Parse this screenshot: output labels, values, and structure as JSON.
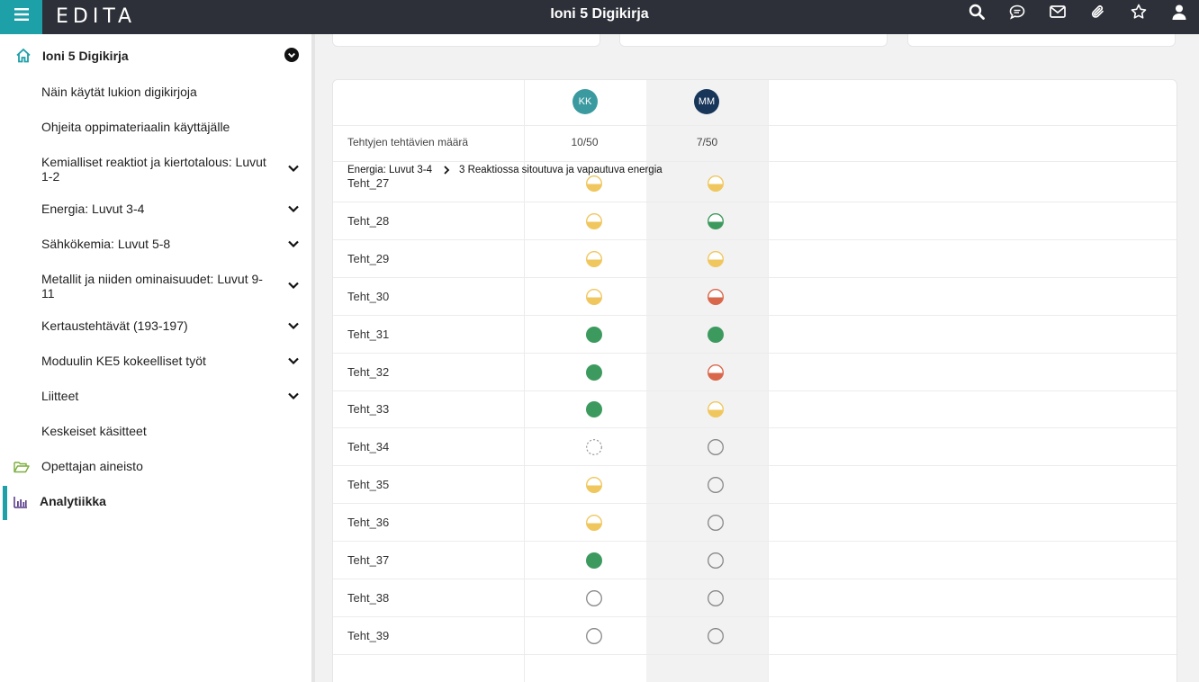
{
  "header": {
    "logo": "EDITA",
    "title": "Ioni 5 Digikirja",
    "icons": [
      "search-icon",
      "chat-icon",
      "mail-icon",
      "attachment-icon",
      "star-icon",
      "user-icon"
    ]
  },
  "sidebar": {
    "root": "Ioni 5 Digikirja",
    "items": [
      {
        "label": "Näin käytät lukion digikirjoja",
        "expandable": false
      },
      {
        "label": "Ohjeita oppimateriaalin käyttäjälle",
        "expandable": false
      },
      {
        "label": "Kemialliset reaktiot ja kiertotalous: Luvut 1-2",
        "expandable": true
      },
      {
        "label": "Energia: Luvut 3-4",
        "expandable": true
      },
      {
        "label": "Sähkökemia: Luvut 5-8",
        "expandable": true
      },
      {
        "label": "Metallit ja niiden ominaisuudet: Luvut 9-11",
        "expandable": true
      },
      {
        "label": "Kertaustehtävät (193-197)",
        "expandable": true
      },
      {
        "label": "Moduulin KE5 kokeelliset työt",
        "expandable": true
      },
      {
        "label": "Liitteet",
        "expandable": true
      },
      {
        "label": "Keskeiset käsitteet",
        "expandable": false
      }
    ],
    "teacher": "Opettajan aineisto",
    "analytics": "Analytiikka"
  },
  "table": {
    "students": [
      {
        "initials": "KK",
        "color": "#3b9aa0",
        "done": "10/50"
      },
      {
        "initials": "MM",
        "color": "#17365a",
        "done": "7/50"
      }
    ],
    "count_label": "Tehtyjen tehtävien määrä",
    "breadcrumb": {
      "chapter": "Energia: Luvut 3-4",
      "section": "3 Reaktiossa sitoutuva ja vapautuva energia"
    },
    "rows": [
      {
        "task": "Teht_27",
        "status": [
          "partial-yellow",
          "partial-yellow"
        ]
      },
      {
        "task": "Teht_28",
        "status": [
          "partial-yellow",
          "partial-green"
        ]
      },
      {
        "task": "Teht_29",
        "status": [
          "partial-yellow",
          "partial-yellow"
        ]
      },
      {
        "task": "Teht_30",
        "status": [
          "partial-yellow",
          "partial-red"
        ]
      },
      {
        "task": "Teht_31",
        "status": [
          "full-green",
          "full-green"
        ]
      },
      {
        "task": "Teht_32",
        "status": [
          "full-green",
          "partial-red"
        ]
      },
      {
        "task": "Teht_33",
        "status": [
          "full-green",
          "partial-yellow"
        ]
      },
      {
        "task": "Teht_34",
        "status": [
          "dashed-empty",
          "empty"
        ]
      },
      {
        "task": "Teht_35",
        "status": [
          "partial-yellow",
          "empty"
        ]
      },
      {
        "task": "Teht_36",
        "status": [
          "partial-yellow",
          "empty"
        ]
      },
      {
        "task": "Teht_37",
        "status": [
          "full-green",
          "empty"
        ]
      },
      {
        "task": "Teht_38",
        "status": [
          "empty",
          "empty"
        ]
      },
      {
        "task": "Teht_39",
        "status": [
          "empty",
          "empty"
        ]
      }
    ]
  },
  "colors": {
    "accent": "#1da0a8",
    "green": "#3d9a5e",
    "yellow": "#f0c75e",
    "red": "#d9674a"
  }
}
